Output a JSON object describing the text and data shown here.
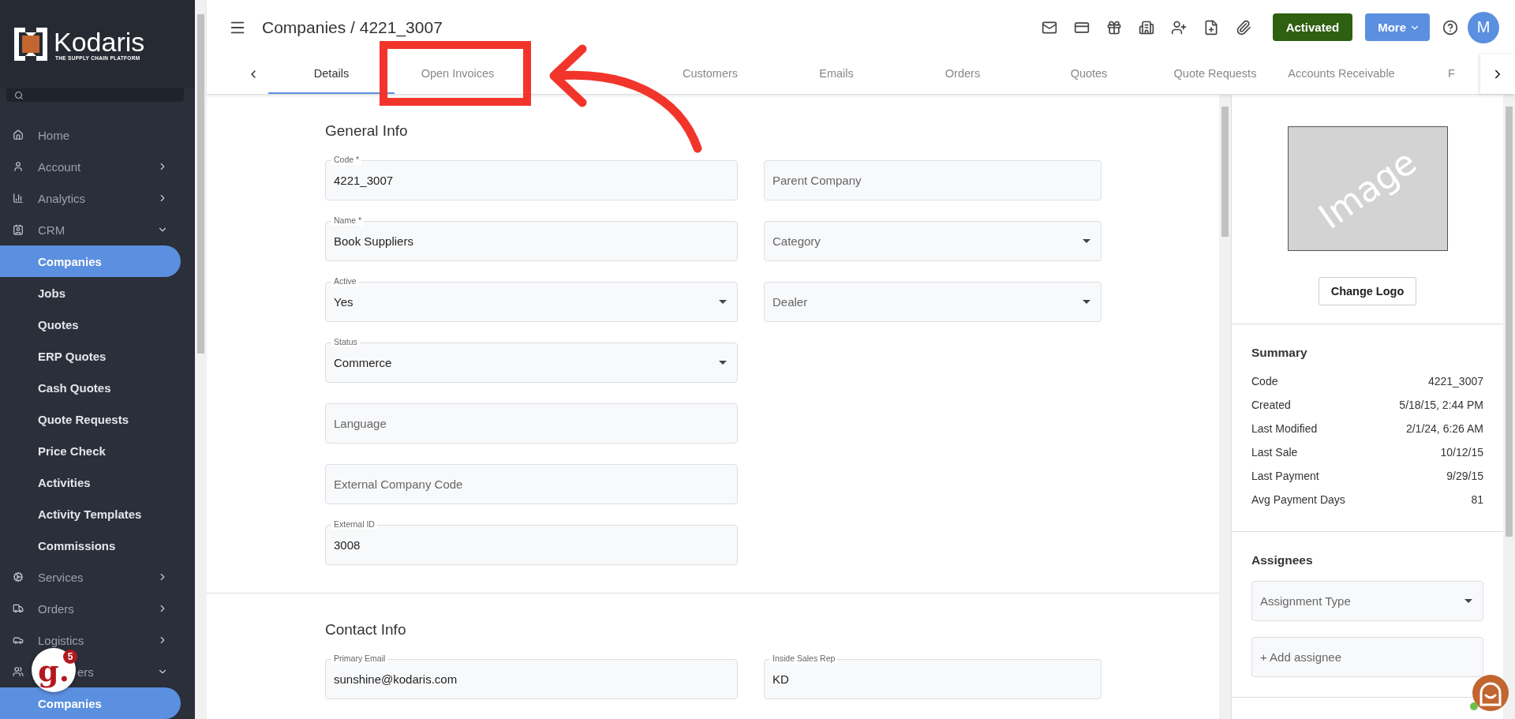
{
  "sidebar": {
    "logo": {
      "name": "Kodaris",
      "tagline": "THE SUPPLY CHAIN PLATFORM"
    },
    "items": [
      {
        "label": "Home",
        "kind": "link",
        "selected": false
      },
      {
        "label": "Account",
        "kind": "menu",
        "expanded": false,
        "selected": false
      },
      {
        "label": "Analytics",
        "kind": "menu",
        "expanded": false,
        "selected": false
      },
      {
        "label": "CRM",
        "kind": "menu",
        "expanded": true,
        "selected": false,
        "children": [
          {
            "label": "Companies",
            "selected": true
          },
          {
            "label": "Jobs",
            "selected": false
          },
          {
            "label": "Quotes",
            "selected": false
          },
          {
            "label": "ERP Quotes",
            "selected": false
          },
          {
            "label": "Cash Quotes",
            "selected": false
          },
          {
            "label": "Quote Requests",
            "selected": false
          },
          {
            "label": "Price Check",
            "selected": false
          },
          {
            "label": "Activities",
            "selected": false
          },
          {
            "label": "Activity Templates",
            "selected": false
          },
          {
            "label": "Commissions",
            "selected": false
          }
        ]
      },
      {
        "label": "Services",
        "kind": "menu",
        "expanded": false,
        "selected": false
      },
      {
        "label": "Orders",
        "kind": "menu",
        "expanded": false,
        "selected": false
      },
      {
        "label": "Logistics",
        "kind": "menu",
        "expanded": false,
        "selected": false
      },
      {
        "label": "ers",
        "kind": "menu",
        "covered": true,
        "expanded": true,
        "selected": false,
        "children": [
          {
            "label": "Companies",
            "selected": true
          }
        ]
      }
    ]
  },
  "header": {
    "title": "Companies / 4221_3007",
    "status_button": "Activated",
    "more_button": "More",
    "avatar": "M"
  },
  "tabs": [
    {
      "label": "Details",
      "selected": true
    },
    {
      "label": "Open Invoices",
      "selected": false
    },
    {
      "label": "Customers",
      "selected": false
    },
    {
      "label": "Emails",
      "selected": false
    },
    {
      "label": "Orders",
      "selected": false
    },
    {
      "label": "Quotes",
      "selected": false
    },
    {
      "label": "Quote Requests",
      "selected": false
    },
    {
      "label": "Accounts Receivable",
      "selected": false
    },
    {
      "label": "F",
      "selected": false
    }
  ],
  "sections": [
    {
      "title": "General Info",
      "left": [
        {
          "kind": "text",
          "label": "Code *",
          "value": "4221_3007"
        },
        {
          "kind": "text",
          "label": "Name *",
          "value": "Book Suppliers"
        },
        {
          "kind": "select",
          "label": "Active",
          "value": "Yes"
        },
        {
          "kind": "select",
          "label": "Status",
          "value": "Commerce"
        },
        {
          "kind": "text",
          "placeholder": "Language"
        },
        {
          "kind": "text",
          "placeholder": "External Company Code"
        },
        {
          "kind": "text",
          "label": "External ID",
          "value": "3008"
        }
      ],
      "right": [
        {
          "kind": "text",
          "placeholder": "Parent Company"
        },
        {
          "kind": "select",
          "placeholder": "Category"
        },
        {
          "kind": "select",
          "placeholder": "Dealer"
        }
      ]
    },
    {
      "title": "Contact Info",
      "left": [
        {
          "kind": "text",
          "label": "Primary Email",
          "value": "sunshine@kodaris.com"
        }
      ],
      "right": [
        {
          "kind": "text",
          "label": "Inside Sales Rep",
          "value": "KD"
        }
      ]
    }
  ],
  "side_panel": {
    "logo_placeholder": "Image",
    "change_logo_button": "Change Logo",
    "summary": {
      "title": "Summary",
      "rows": [
        {
          "label": "Code",
          "value": "4221_3007"
        },
        {
          "label": "Created",
          "value": "5/18/15, 2:44 PM"
        },
        {
          "label": "Last Modified",
          "value": "2/1/24, 6:26 AM"
        },
        {
          "label": "Last Sale",
          "value": "10/12/15"
        },
        {
          "label": "Last Payment",
          "value": "9/29/15"
        },
        {
          "label": "Avg Payment Days",
          "value": "81"
        }
      ]
    },
    "assignees": {
      "title": "Assignees",
      "type_placeholder": "Assignment Type",
      "add_placeholder": "+ Add assignee"
    }
  },
  "help_badge": {
    "logo": "g.",
    "count": "5"
  }
}
